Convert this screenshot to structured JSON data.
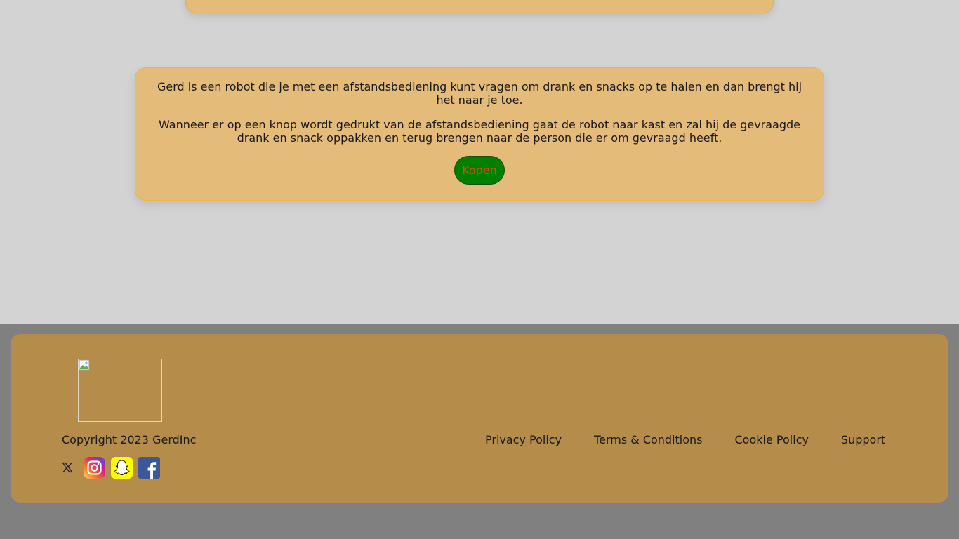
{
  "product": {
    "paragraph_1": "Gerd is een robot die je met een afstandsbediening kunt vragen om drank en snacks op te halen en dan brengt hij het naar je toe.",
    "paragraph_2": "Wanneer er op een knop wordt gedrukt van de afstandsbediening gaat de robot naar kast en zal hij de gevraagde drank en snack oppakken en terug brengen naar de person die er om gevraagd heeft.",
    "buy_label": "Kopen"
  },
  "footer": {
    "copyright": "Copyright 2023 GerdInc",
    "links": [
      "Privacy Policy",
      "Terms & Conditions",
      "Cookie Policy",
      "Support"
    ],
    "socials": [
      "x-icon",
      "instagram-icon",
      "snapchat-icon",
      "facebook-icon"
    ]
  },
  "colors": {
    "card_bg": "#e5bb79",
    "footer_bg": "#b58c4a",
    "page_bg": "#d3d3d3",
    "button_bg": "#008000",
    "button_text": "#d35400"
  }
}
